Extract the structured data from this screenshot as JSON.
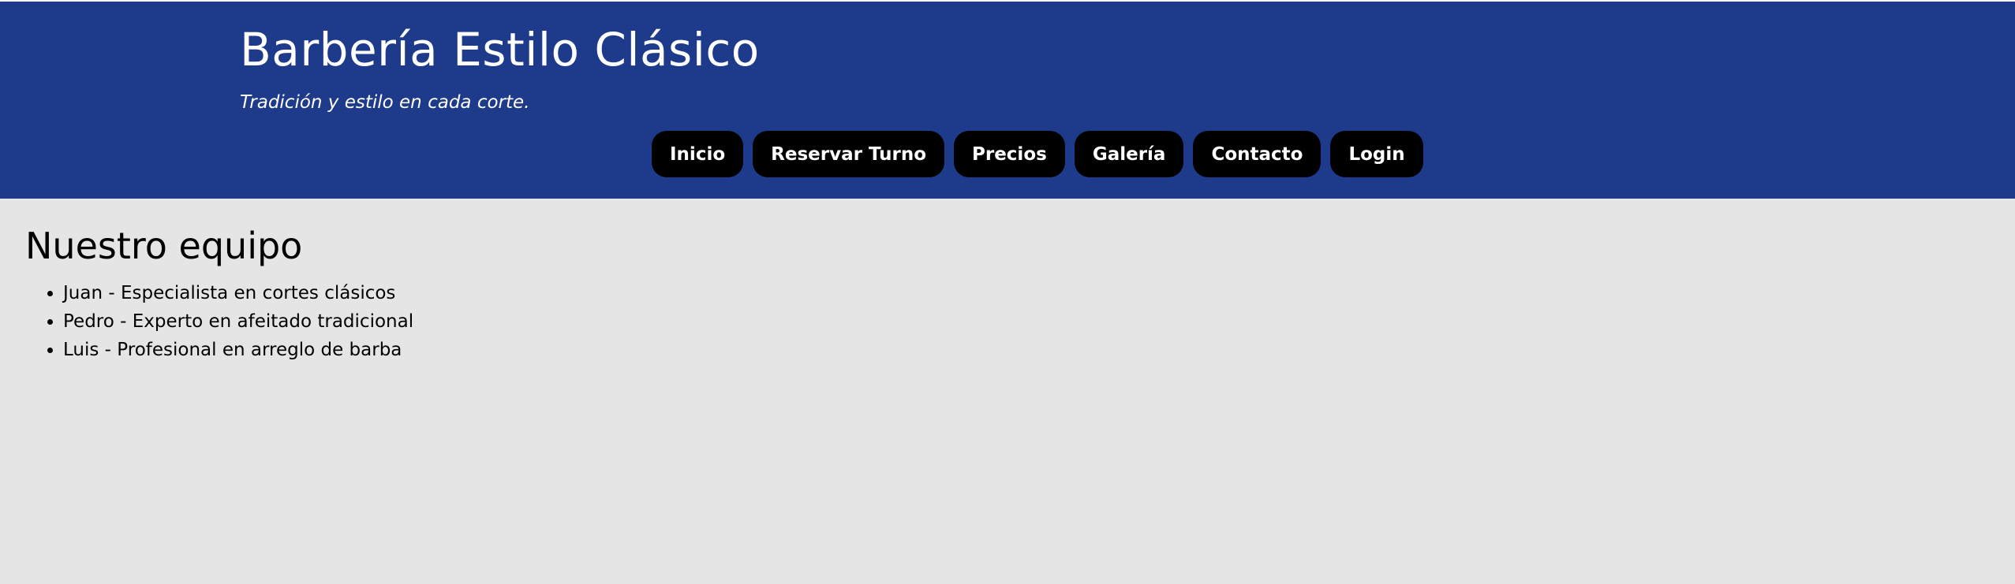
{
  "header": {
    "title": "Barbería Estilo Clásico",
    "tagline": "Tradición y estilo en cada corte.",
    "background": "#1e3a8a"
  },
  "nav": {
    "items": [
      {
        "label": "Inicio"
      },
      {
        "label": "Reservar Turno"
      },
      {
        "label": "Precios"
      },
      {
        "label": "Galería"
      },
      {
        "label": "Contacto"
      },
      {
        "label": "Login"
      }
    ]
  },
  "main": {
    "title": "Nuestro equipo",
    "team": [
      "Juan - Especialista en cortes clásicos",
      "Pedro - Experto en afeitado tradicional",
      "Luis - Profesional en arreglo de barba"
    ]
  }
}
